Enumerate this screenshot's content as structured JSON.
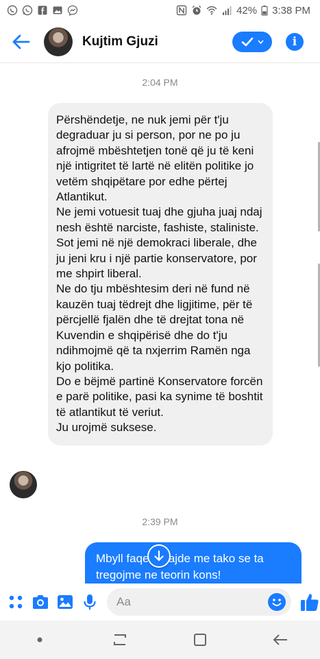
{
  "status": {
    "battery": "42%",
    "time": "3:38 PM",
    "left_icons": [
      "viber-icon",
      "whatsapp-icon",
      "facebook-icon",
      "gallery-icon",
      "messenger-icon"
    ],
    "right_icons": [
      "nfc-icon",
      "alarm-icon",
      "wifi-icon",
      "signal-icon",
      "battery-icon"
    ]
  },
  "header": {
    "contact_name": "Kujtim Gjuzi"
  },
  "chat": {
    "timestamp_1": "2:04 PM",
    "incoming_message": "Përshëndetje, ne nuk jemi për t'ju degraduar ju si person, por ne po ju afrojmë mbështetjen tonë që ju të keni një intigritet të lartë në elitën politike jo vetëm shqipëtare por edhe përtej Atlantikut.\nNe jemi votuesit tuaj dhe gjuha juaj ndaj nesh është narciste, fashiste, staliniste.\nSot jemi në një demokraci liberale, dhe ju jeni kru i një partie konservatore, por me shpirt liberal.\nNe do tju mbështesim deri në fund në kauzën tuaj tëdrejt dhe ligjitime, për të përcjellë fjalën dhe të drejtat tona në Kuvendin e shqipërisë dhe do t'ju ndihmojmë që ta nxjerrim Ramën nga kjo politika.\nDo e bëjmë partinë Konservatore forcën e parë politike, pasi ka synime të boshtit të atlantikut të veriut.\nJu urojmë suksese.",
    "timestamp_2": "2:39 PM",
    "outgoing_message": "Mbyll faqen    ajde me tako se ta tregojme ne teorin kons!"
  },
  "composer": {
    "placeholder": "Aa"
  },
  "colors": {
    "accent": "#1a7cff",
    "incoming_bubble": "#f0f0f0",
    "navbar": "#f3f3f3"
  }
}
